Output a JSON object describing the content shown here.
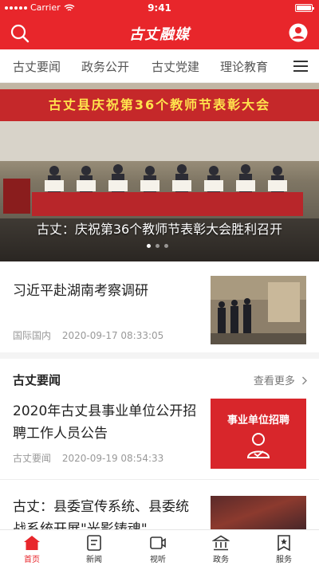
{
  "status": {
    "carrier": "Carrier",
    "time": "9:41"
  },
  "header": {
    "logo": "古丈融媒",
    "search_icon": "search-icon",
    "user_icon": "user-icon"
  },
  "tabs": [
    {
      "label": "古丈要闻"
    },
    {
      "label": "政务公开"
    },
    {
      "label": "古丈党建"
    },
    {
      "label": "理论教育"
    }
  ],
  "banner": {
    "stage_text": "古丈县庆祝第36个教师节表彰大会",
    "caption": "古丈：庆祝第36个教师节表彰大会胜利召开"
  },
  "featured": {
    "title": "习近平赴湖南考察调研",
    "source": "国际国内",
    "time": "2020-09-17 08:33:05"
  },
  "section": {
    "title": "古丈要闻",
    "more": "查看更多"
  },
  "news": [
    {
      "title": "2020年古丈县事业单位公开招聘工作人员公告",
      "source": "古丈要闻",
      "time": "2020-09-19 08:54:33",
      "thumb_label": "事业单位招聘"
    },
    {
      "title": "古丈：县委宣传系统、县委统战系统开展\"光影铸魂\""
    }
  ],
  "tabbar": [
    {
      "label": "首页",
      "icon": "home-icon",
      "active": true
    },
    {
      "label": "新闻",
      "icon": "news-icon"
    },
    {
      "label": "视听",
      "icon": "video-icon"
    },
    {
      "label": "政务",
      "icon": "government-icon"
    },
    {
      "label": "服务",
      "icon": "service-icon"
    }
  ],
  "colors": {
    "brand": "#e8262b",
    "active_tab": "#e8262b"
  }
}
